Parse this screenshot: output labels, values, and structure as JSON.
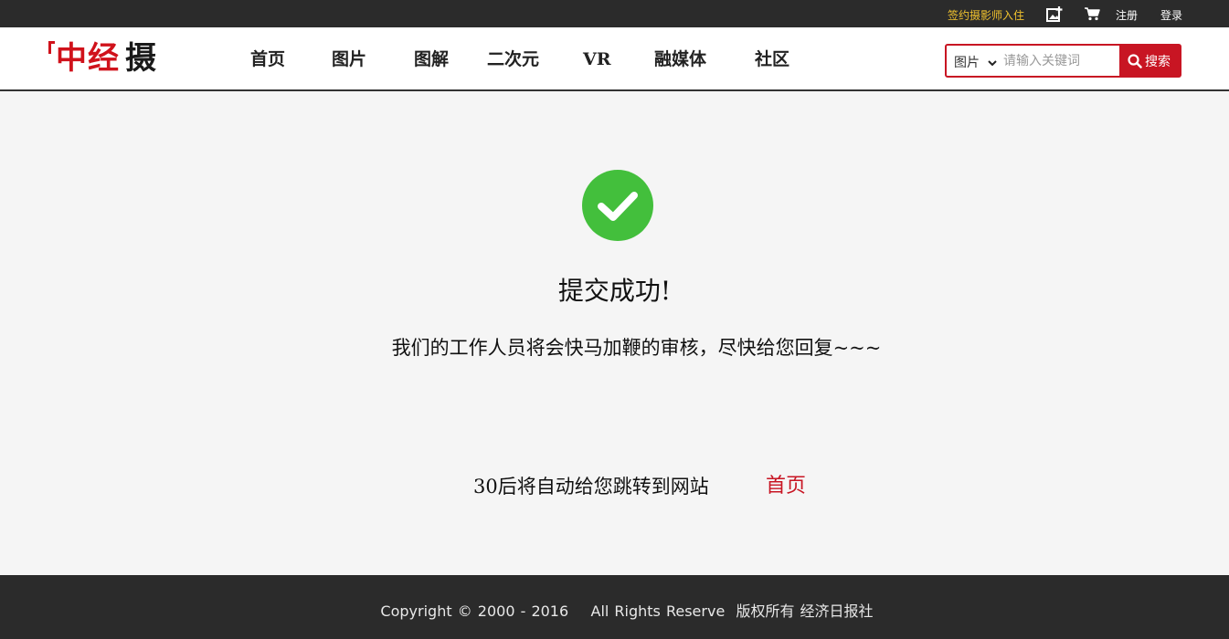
{
  "topbar": {
    "sign_label": "签约摄影师入住",
    "upload_icon": "upload-image-icon",
    "cart_icon": "cart-icon",
    "register_label": "注册",
    "login_label": "登录"
  },
  "logo": {
    "char1": "中",
    "char2": "经",
    "char3": "摄"
  },
  "nav": [
    "首页",
    "图片",
    "图解",
    "二次元",
    "VR",
    "融媒体",
    "社区"
  ],
  "search": {
    "category": "图片",
    "placeholder": "请输入关键词",
    "button_label": "搜索"
  },
  "result": {
    "title": "提交成功!",
    "message": "我们的工作人员将会快马加鞭的审核，尽快给您回复~~~",
    "redirect_text": "30后将自动给您跳转到网站",
    "home_link": "首页"
  },
  "footer": {
    "copyright": "Copyright © 2000 - 2016    All Rights Reserve  版权所有 经济日报社"
  },
  "colors": {
    "brand_red": "#c81523",
    "success_green": "#43bf3c",
    "dark_bar": "#2b2b2b",
    "sign_yellow": "#f0c22e"
  }
}
